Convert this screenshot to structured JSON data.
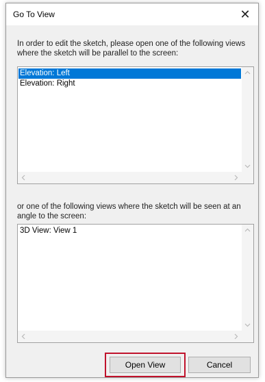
{
  "window": {
    "title": "Go To View"
  },
  "prompts": {
    "parallel": "In order to edit the sketch, please open one of the following views where the sketch will be parallel to the screen:",
    "angle": "or one of the following views where the sketch will be seen at an angle to the screen:"
  },
  "parallel_views": {
    "items": [
      {
        "label": "Elevation: Left",
        "selected": true
      },
      {
        "label": "Elevation: Right",
        "selected": false
      }
    ]
  },
  "angle_views": {
    "items": [
      {
        "label": "3D View: View 1",
        "selected": false
      }
    ]
  },
  "buttons": {
    "open": "Open View",
    "cancel": "Cancel"
  },
  "colors": {
    "selection": "#0078d7",
    "highlight_frame": "#c0112b"
  },
  "icons": {
    "close": "close-icon",
    "scroll_up": "chevron-up-icon",
    "scroll_down": "chevron-down-icon",
    "scroll_left": "chevron-left-icon",
    "scroll_right": "chevron-right-icon"
  }
}
